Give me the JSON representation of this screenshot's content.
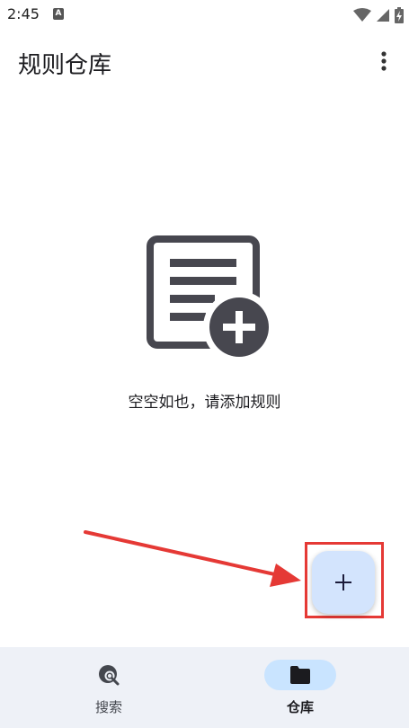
{
  "status_bar": {
    "time": "2:45",
    "notification_icon": "a-icon",
    "icons": [
      "wifi-icon",
      "signal-icon",
      "battery-icon"
    ]
  },
  "app_bar": {
    "title": "规则仓库",
    "overflow_icon": "more-vert-icon"
  },
  "empty_state": {
    "icon": "add-document-icon",
    "message": "空空如也，请添加规则"
  },
  "fab": {
    "icon": "plus-icon",
    "label": "+"
  },
  "bottom_nav": {
    "items": [
      {
        "label": "搜索",
        "icon": "explore-search-icon",
        "selected": false
      },
      {
        "label": "仓库",
        "icon": "folder-icon",
        "selected": true
      }
    ]
  },
  "colors": {
    "fab_bg": "#d3e4fd",
    "nav_bg": "#eef1f7",
    "nav_selected": "#c9e4ff",
    "annotation": "#e53935"
  }
}
